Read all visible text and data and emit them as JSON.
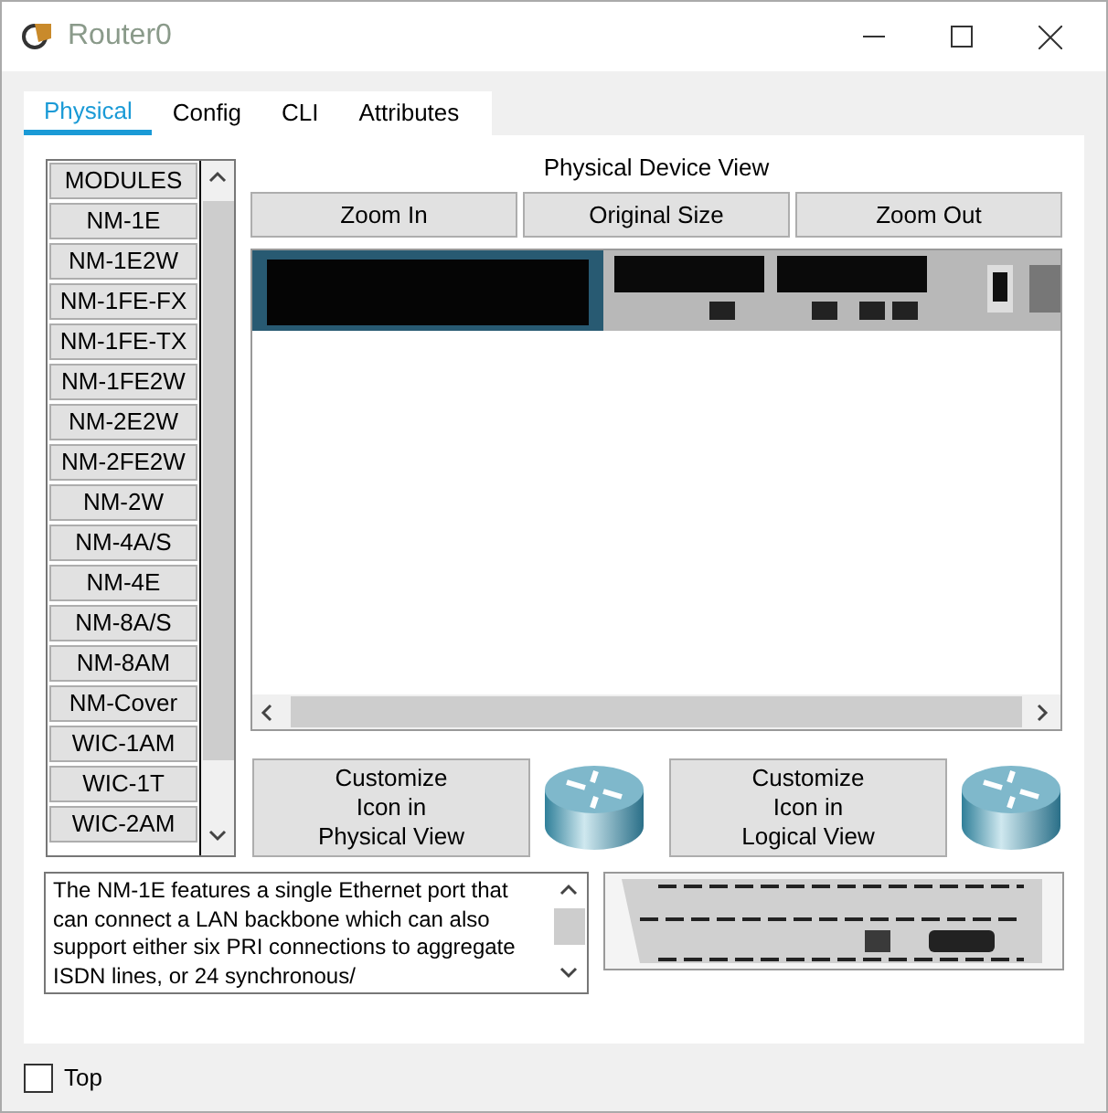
{
  "window": {
    "title": "Router0"
  },
  "tabs": [
    {
      "label": "Physical",
      "selected": true
    },
    {
      "label": "Config",
      "selected": false
    },
    {
      "label": "CLI",
      "selected": false
    },
    {
      "label": "Attributes",
      "selected": false
    }
  ],
  "modules": {
    "header": "MODULES",
    "items": [
      "NM-1E",
      "NM-1E2W",
      "NM-1FE-FX",
      "NM-1FE-TX",
      "NM-1FE2W",
      "NM-2E2W",
      "NM-2FE2W",
      "NM-2W",
      "NM-4A/S",
      "NM-4E",
      "NM-8A/S",
      "NM-8AM",
      "NM-Cover",
      "WIC-1AM",
      "WIC-1T",
      "WIC-2AM"
    ]
  },
  "device_view": {
    "title": "Physical Device View",
    "buttons": [
      "Zoom In",
      "Original Size",
      "Zoom Out"
    ]
  },
  "customize_buttons": [
    "Customize\nIcon in\nPhysical View",
    "Customize\nIcon in\nLogical View"
  ],
  "description": "The NM-1E features a single Ethernet port that can connect a LAN backbone which can also support either six PRI connections to aggregate ISDN lines, or 24 synchronous/",
  "top_checkbox": {
    "label": "Top",
    "checked": false
  }
}
